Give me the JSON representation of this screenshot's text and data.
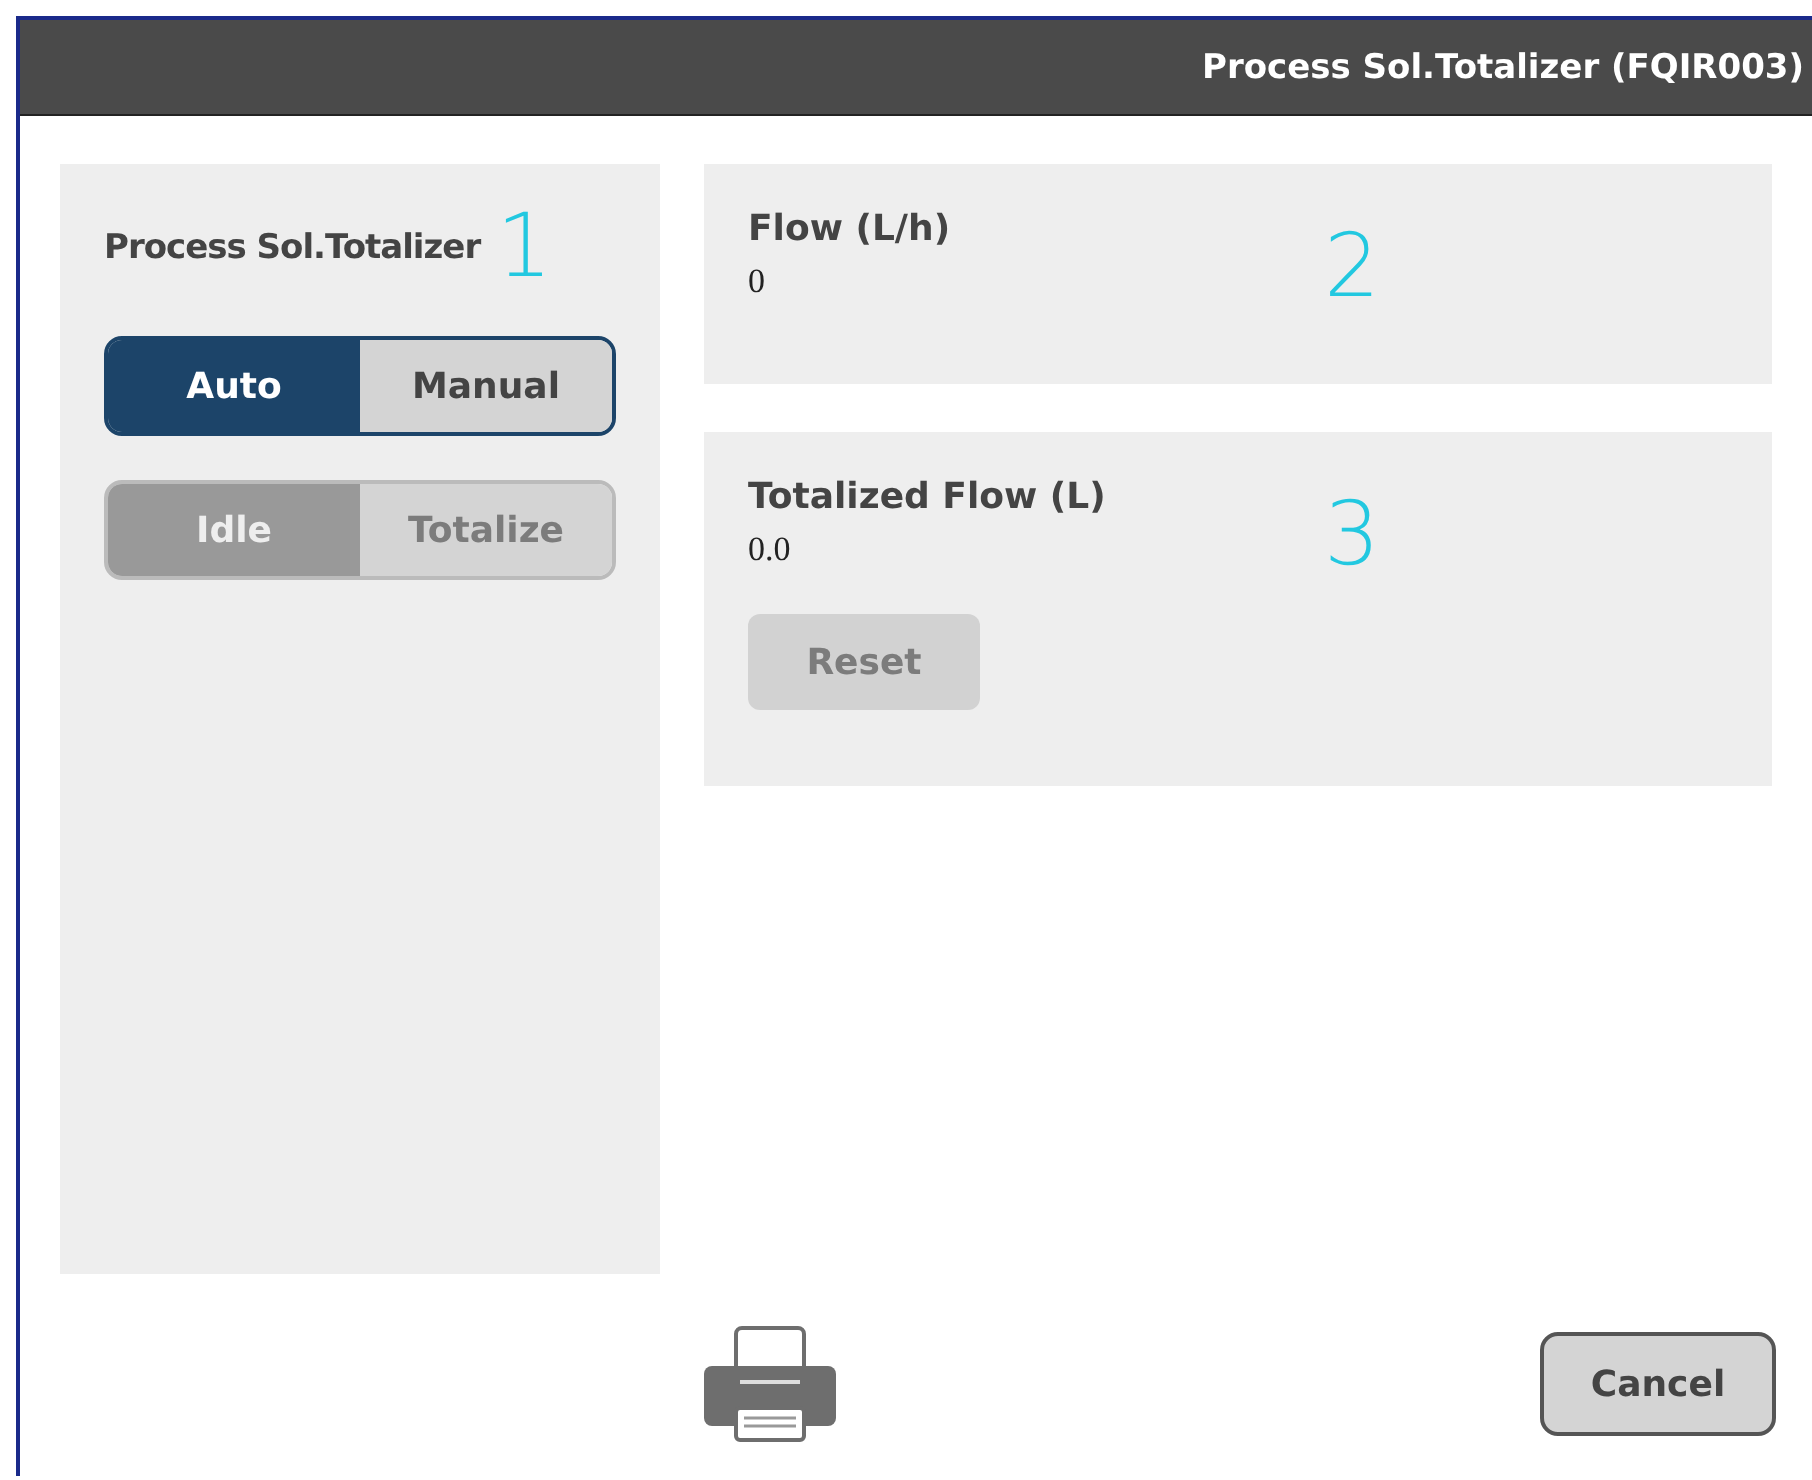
{
  "window": {
    "title": "Process Sol.Totalizer (FQIR003)"
  },
  "left_panel": {
    "title": "Process Sol.Totalizer",
    "annotation": "1",
    "toggles": [
      {
        "disabled": false,
        "options": [
          {
            "label": "Auto",
            "selected": true
          },
          {
            "label": "Manual",
            "selected": false
          }
        ]
      },
      {
        "disabled": true,
        "options": [
          {
            "label": "Idle",
            "selected": true
          },
          {
            "label": "Totalize",
            "selected": false
          }
        ]
      }
    ]
  },
  "panels": [
    {
      "label": "Flow (L/h)",
      "value": "0",
      "annotation": "2"
    },
    {
      "label": "Totalized Flow (L)",
      "value": "0.0",
      "annotation": "3",
      "button": {
        "label": "Reset",
        "disabled": true
      }
    }
  ],
  "footer": {
    "cancel": "Cancel"
  }
}
